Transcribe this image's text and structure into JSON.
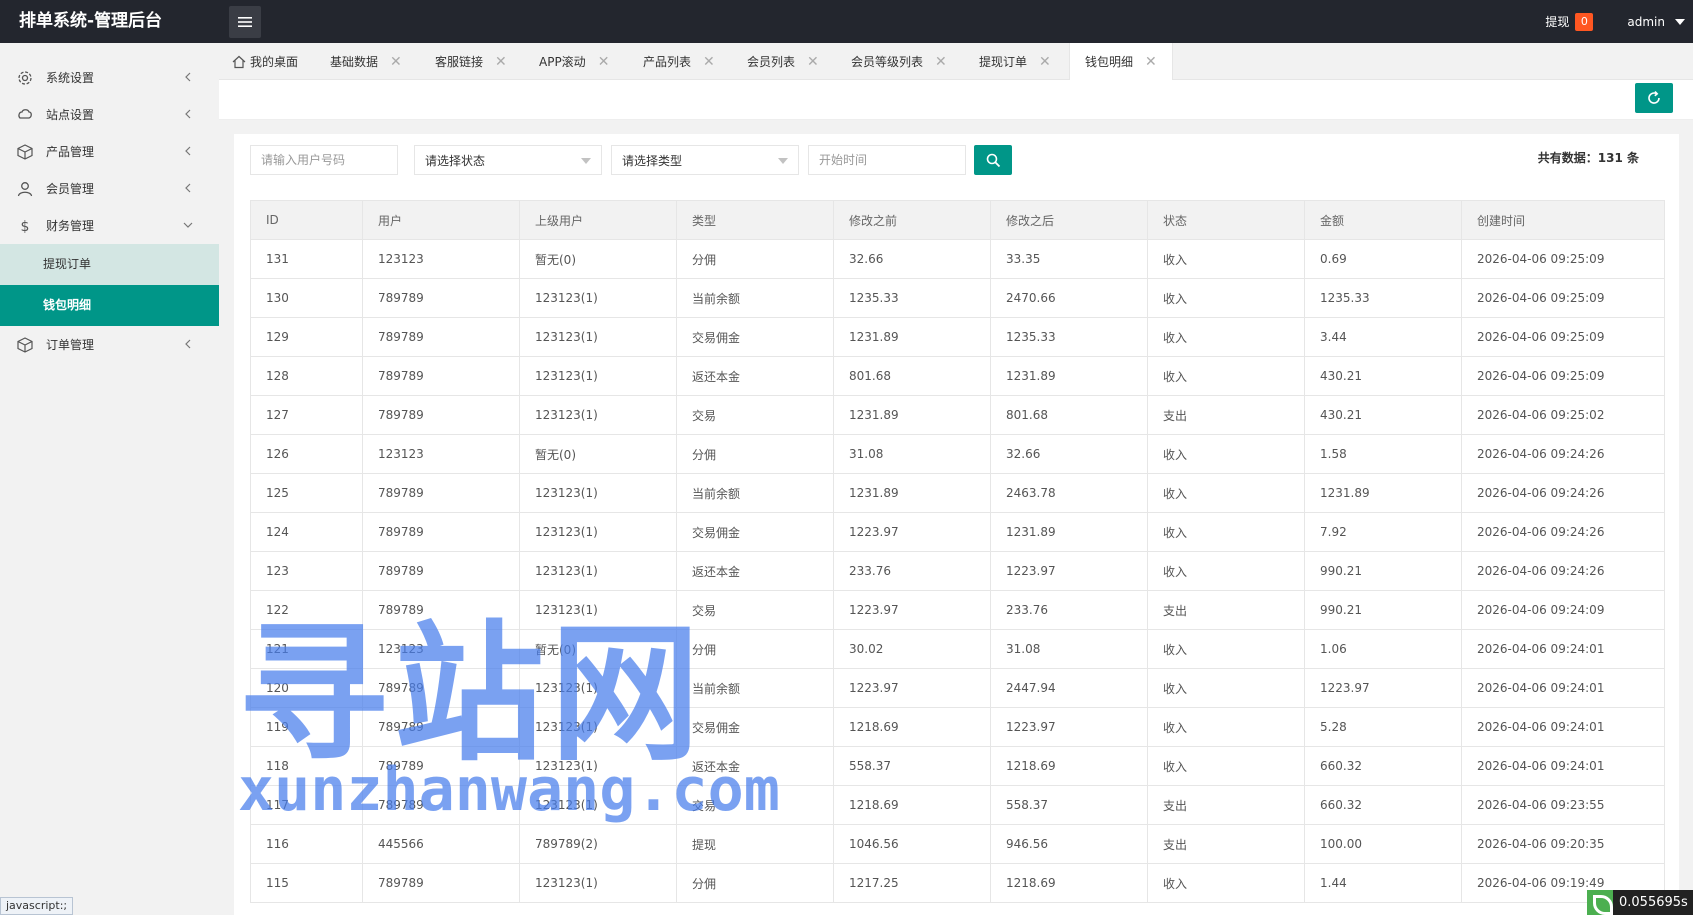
{
  "header": {
    "title": "排单系统-管理后台",
    "withdraw_label": "提现",
    "withdraw_count": "0",
    "user": "admin"
  },
  "sidebar": {
    "items": [
      {
        "label": "系统设置",
        "icon": "gear-icon"
      },
      {
        "label": "站点设置",
        "icon": "site-icon"
      },
      {
        "label": "产品管理",
        "icon": "box-icon"
      },
      {
        "label": "会员管理",
        "icon": "user-icon"
      },
      {
        "label": "财务管理",
        "icon": "dollar-icon"
      },
      {
        "label": "订单管理",
        "icon": "box-icon"
      }
    ],
    "sub_items": [
      {
        "label": "提现订单"
      },
      {
        "label": "钱包明细"
      }
    ]
  },
  "tabs": [
    {
      "label": "我的桌面"
    },
    {
      "label": "基础数据"
    },
    {
      "label": "客服链接"
    },
    {
      "label": "APP滚动"
    },
    {
      "label": "产品列表"
    },
    {
      "label": "会员列表"
    },
    {
      "label": "会员等级列表"
    },
    {
      "label": "提现订单"
    },
    {
      "label": "钱包明细"
    }
  ],
  "filters": {
    "user_placeholder": "请输入用户号码",
    "status_select": "请选择状态",
    "type_select": "请选择类型",
    "start_time_placeholder": "开始时间"
  },
  "total": {
    "label": "共有数据：",
    "count": "131",
    "unit": " 条"
  },
  "table": {
    "columns": [
      "ID",
      "用户",
      "上级用户",
      "类型",
      "修改之前",
      "修改之后",
      "状态",
      "金额",
      "创建时间"
    ],
    "rows": [
      [
        "131",
        "123123",
        "暂无(0)",
        "分佣",
        "32.66",
        "33.35",
        "收入",
        "0.69",
        "2026-04-06 09:25:09"
      ],
      [
        "130",
        "789789",
        "123123(1)",
        "当前余额",
        "1235.33",
        "2470.66",
        "收入",
        "1235.33",
        "2026-04-06 09:25:09"
      ],
      [
        "129",
        "789789",
        "123123(1)",
        "交易佣金",
        "1231.89",
        "1235.33",
        "收入",
        "3.44",
        "2026-04-06 09:25:09"
      ],
      [
        "128",
        "789789",
        "123123(1)",
        "返还本金",
        "801.68",
        "1231.89",
        "收入",
        "430.21",
        "2026-04-06 09:25:09"
      ],
      [
        "127",
        "789789",
        "123123(1)",
        "交易",
        "1231.89",
        "801.68",
        "支出",
        "430.21",
        "2026-04-06 09:25:02"
      ],
      [
        "126",
        "123123",
        "暂无(0)",
        "分佣",
        "31.08",
        "32.66",
        "收入",
        "1.58",
        "2026-04-06 09:24:26"
      ],
      [
        "125",
        "789789",
        "123123(1)",
        "当前余额",
        "1231.89",
        "2463.78",
        "收入",
        "1231.89",
        "2026-04-06 09:24:26"
      ],
      [
        "124",
        "789789",
        "123123(1)",
        "交易佣金",
        "1223.97",
        "1231.89",
        "收入",
        "7.92",
        "2026-04-06 09:24:26"
      ],
      [
        "123",
        "789789",
        "123123(1)",
        "返还本金",
        "233.76",
        "1223.97",
        "收入",
        "990.21",
        "2026-04-06 09:24:26"
      ],
      [
        "122",
        "789789",
        "123123(1)",
        "交易",
        "1223.97",
        "233.76",
        "支出",
        "990.21",
        "2026-04-06 09:24:09"
      ],
      [
        "121",
        "123123",
        "暂无(0)",
        "分佣",
        "30.02",
        "31.08",
        "收入",
        "1.06",
        "2026-04-06 09:24:01"
      ],
      [
        "120",
        "789789",
        "123123(1)",
        "当前余额",
        "1223.97",
        "2447.94",
        "收入",
        "1223.97",
        "2026-04-06 09:24:01"
      ],
      [
        "119",
        "789789",
        "123123(1)",
        "交易佣金",
        "1218.69",
        "1223.97",
        "收入",
        "5.28",
        "2026-04-06 09:24:01"
      ],
      [
        "118",
        "789789",
        "123123(1)",
        "返还本金",
        "558.37",
        "1218.69",
        "收入",
        "660.32",
        "2026-04-06 09:24:01"
      ],
      [
        "117",
        "789789",
        "123123(1)",
        "交易",
        "1218.69",
        "558.37",
        "支出",
        "660.32",
        "2026-04-06 09:23:55"
      ],
      [
        "116",
        "445566",
        "789789(2)",
        "提现",
        "1046.56",
        "946.56",
        "支出",
        "100.00",
        "2026-04-06 09:20:35"
      ],
      [
        "115",
        "789789",
        "123123(1)",
        "分佣",
        "1217.25",
        "1218.69",
        "收入",
        "1.44",
        "2026-04-06 09:19:49"
      ]
    ]
  },
  "watermark": {
    "line1": "寻站网",
    "line2": "xunzhanwang.com"
  },
  "statusbar": {
    "text": "javascript:;"
  },
  "timer": {
    "text": "0.055695s"
  },
  "colors": {
    "header_bg": "#23262e",
    "accent": "#009688",
    "badge": "#ff5722",
    "sub_light": "#d3e6e3"
  }
}
